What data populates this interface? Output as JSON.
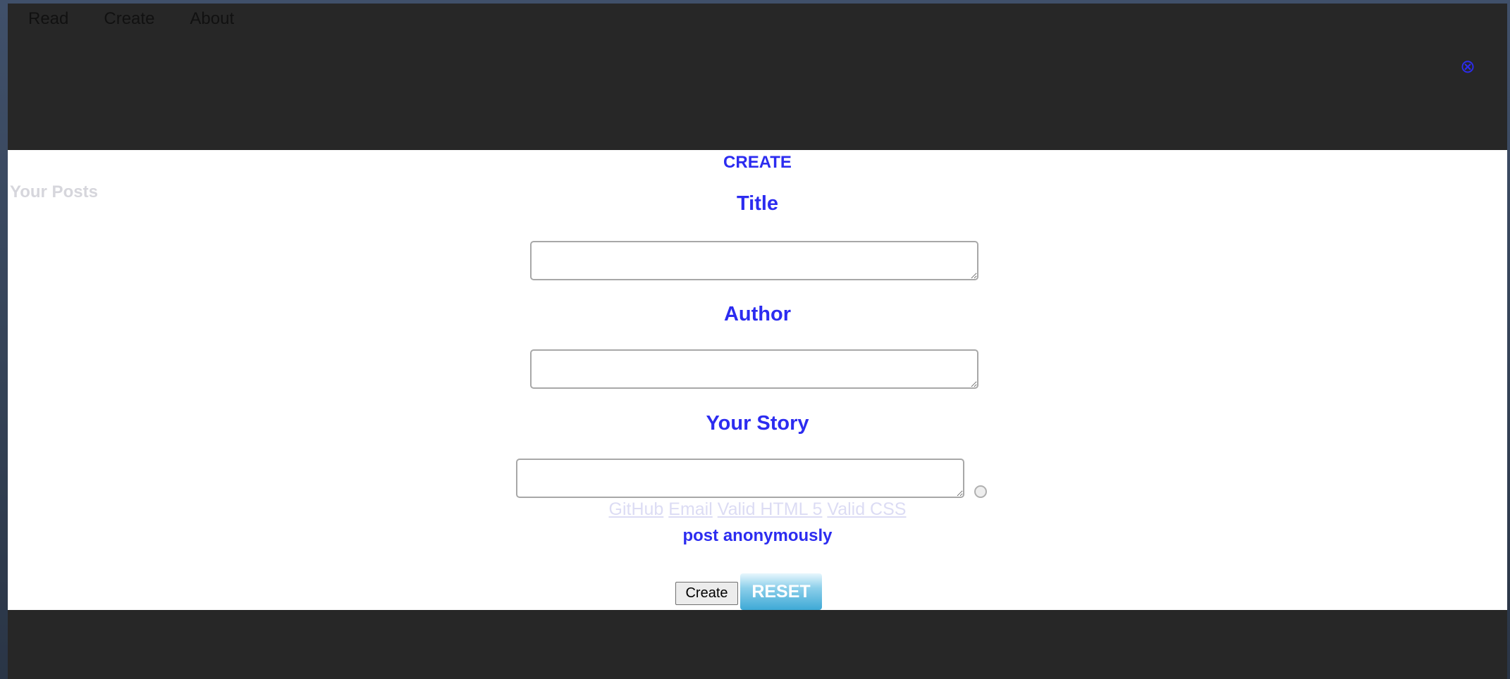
{
  "nav": {
    "items": [
      {
        "label": "Read"
      },
      {
        "label": "Create"
      },
      {
        "label": "About"
      }
    ]
  },
  "header": {
    "close_icon": "close-icon",
    "close_glyph": "⊗",
    "close_color": "#2c2cf0"
  },
  "sidebar": {
    "your_posts": "Your Posts"
  },
  "form": {
    "heading": "CREATE",
    "title_label": "Title",
    "title_value": "",
    "author_label": "Author",
    "author_value": "",
    "story_label": "Your Story",
    "story_value": "",
    "anonymous_label": "post anonymously",
    "anonymous_checked": false,
    "create_button": "Create",
    "reset_button": "RESET"
  },
  "footer": {
    "links": [
      {
        "label": "GitHub"
      },
      {
        "label": "Email"
      },
      {
        "label": "Valid HTML 5"
      },
      {
        "label": "Valid CSS"
      }
    ]
  },
  "colors": {
    "accent": "#2c2cf0",
    "background": "#272727",
    "panel": "#ffffff",
    "reset_button": "#3ea9d6"
  }
}
